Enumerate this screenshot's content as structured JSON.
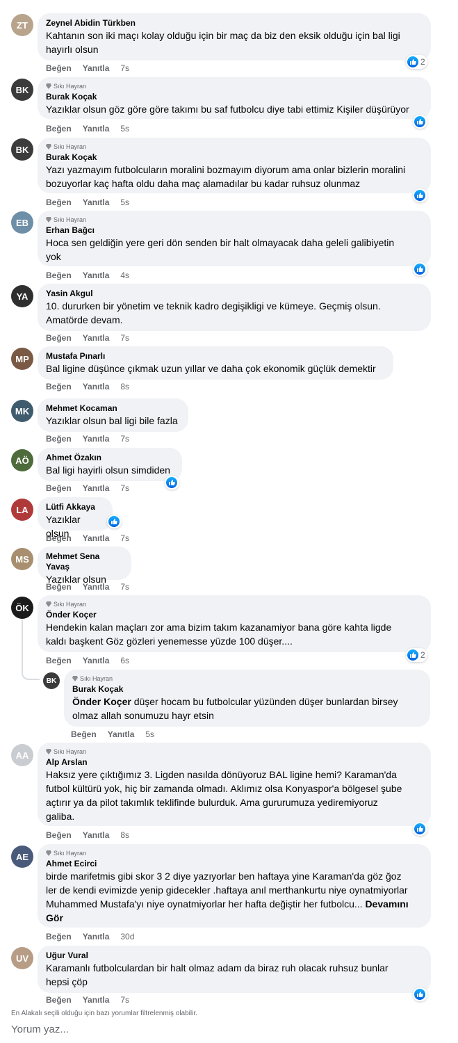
{
  "badge_label": "Sıkı Hayran",
  "actions": {
    "like": "Beğen",
    "reply": "Yanıtla"
  },
  "comments": [
    {
      "avatar": "ZT",
      "author": "Zeynel Abidin Türkben",
      "lines": [
        "Kahtanın son iki maçı kolay olduğu için bir maç da biz den eksik olduğu için bal ligi",
        "hayırlı olsun"
      ],
      "time": "7s",
      "reactions": "2"
    },
    {
      "avatar": "BK",
      "badge": true,
      "author": "Burak Koçak",
      "lines": [
        "Yazıklar olsun göz göre göre takımı bu saf futbolcu diye tabi ettimiz Kişiler düşürüyor"
      ],
      "time": "5s"
    },
    {
      "avatar": "BK",
      "badge": true,
      "author": "Burak Koçak",
      "lines": [
        "Yazı yazmayım futbolcuların moralini bozmayım diyorum ama onlar bizlerin moralini",
        "bozuyorlar kaç hafta oldu daha maç alamadılar bu kadar ruhsuz olunmaz"
      ],
      "time": "5s"
    },
    {
      "avatar": "EB",
      "badge": true,
      "author": "Erhan Bağcı",
      "lines": [
        "Hoca sen geldiğin yere geri dön senden bir halt olmayacak daha geleli galibiyetin",
        "yok"
      ],
      "time": "4s"
    },
    {
      "avatar": "YA",
      "author": "Yasin Akgul",
      "lines": [
        "10. dururken bir yönetim ve teknik kadro degişikligi ve kümeye. Geçmiş olsun.",
        "Amatörde devam."
      ],
      "time": "7s"
    },
    {
      "avatar": "MP",
      "author": "Mustafa Pınarlı",
      "lines": [
        "Bal ligine düşünce çıkmak uzun yıllar ve daha çok ekonomik güçlük demektir"
      ],
      "time": "8s"
    },
    {
      "avatar": "MK",
      "author": "Mehmet Kocaman",
      "lines": [
        "Yazıklar olsun bal ligi bile fazla"
      ],
      "time": "7s"
    },
    {
      "avatar": "AÖ",
      "author": "Ahmet Özakın",
      "lines": [
        "Bal ligi hayirli olsun simdiden"
      ],
      "time": "7s"
    },
    {
      "avatar": "LA",
      "author": "Lütfi Akkaya",
      "lines": [
        "Yazıklar olsun"
      ],
      "time": "7s"
    },
    {
      "avatar": "MS",
      "author": "Mehmet Sena Yavaş",
      "lines": [
        "Yazıklar olsun"
      ],
      "time": "7s"
    },
    {
      "avatar": "ÖK",
      "badge": true,
      "author": "Önder Koçer",
      "lines": [
        "Hendekin kalan maçları zor ama bizim takım kazanamiyor bana göre kahta ligde",
        "kaldı başkent Göz gözleri yenemesse yüzde 100 düşer...."
      ],
      "time": "6s",
      "reactions": "2"
    },
    {
      "avatar": "BK",
      "badge": true,
      "author": "Burak Koçak",
      "mention": "Önder Koçer",
      "lines": [
        " düşer hocam bu futbolcular yüzünden düşer bunlardan birsey",
        "olmaz allah sonumuzu hayr etsin"
      ],
      "time": "5s"
    },
    {
      "avatar": "AA",
      "badge": true,
      "author": "Alp Arslan",
      "lines": [
        "Haksız yere çıktığımız 3. Ligden nasılda dönüyoruz BAL ligine hemi? Karaman'da",
        "futbol kültürü yok, hiç bir zamanda olmadı. Aklımız olsa Konyaspor'a bölgesel şube",
        "açtırır ya da pilot takımlık teklifinde bulurduk. Ama gururumuza yediremiyoruz",
        "galiba."
      ],
      "time": "8s"
    },
    {
      "avatar": "AE",
      "badge": true,
      "author": "Ahmet Ecirci",
      "lines": [
        "birde marifetmis gibi skor 3 2 diye yazıyorlar ben haftaya yine Karaman'da göz ğoz",
        "ler de kendi evimizde yenip gidecekler .haftaya anıl merthankurtu niye oynatmiyorlar",
        "Muhammed Mustafa'yı niye oynatmiyorlar her hafta değiştir her futbolcu... "
      ],
      "more": "Devamını",
      "more2": "Gör",
      "time": "30d"
    },
    {
      "avatar": "UV",
      "author": "Uğur Vural",
      "lines": [
        "Karamanlı futbolculardan bir halt olmaz adam da biraz ruh olacak ruhsuz bunlar",
        "hepsi çöp"
      ],
      "time": "7s"
    }
  ],
  "filter_note": "En Alakalı seçili olduğu için bazı yorumlar filtrelenmiş olabilir.",
  "write_placeholder": "Yorum yaz...",
  "colors": {
    "bubble": "#f0f2f5",
    "secondary_text": "#65676b",
    "like_blue": "#0866ff"
  }
}
